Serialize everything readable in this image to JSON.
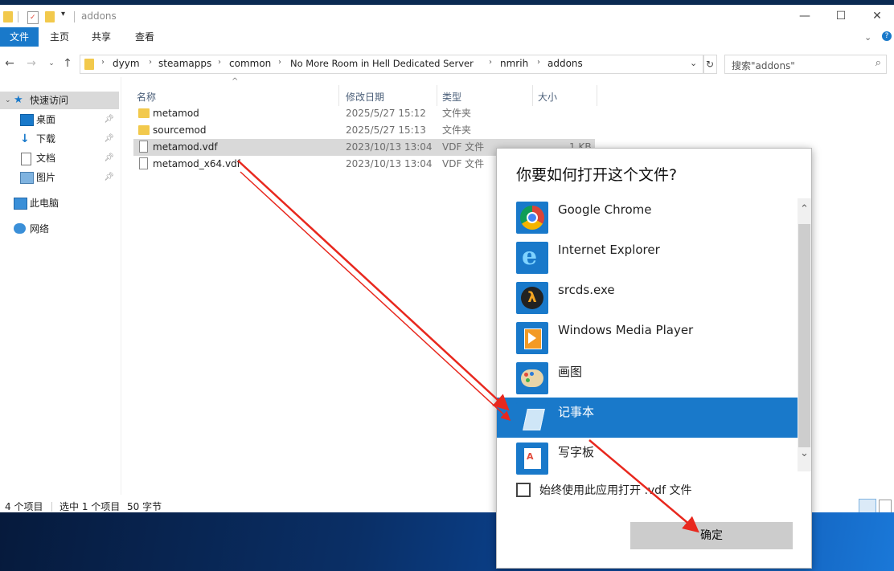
{
  "window": {
    "title": "addons"
  },
  "ribbon": {
    "tabs": [
      "文件",
      "主页",
      "共享",
      "查看"
    ]
  },
  "address": {
    "crumbs": [
      "dyym",
      "steamapps",
      "common",
      "No More Room in Hell Dedicated Server",
      "nmrih",
      "addons"
    ],
    "search_placeholder": "搜索\"addons\""
  },
  "nav": {
    "items": [
      {
        "label": "快速访问",
        "icon": "star-icon"
      },
      {
        "label": "桌面",
        "icon": "desktop-icon"
      },
      {
        "label": "下载",
        "icon": "download-icon"
      },
      {
        "label": "文档",
        "icon": "document-icon"
      },
      {
        "label": "图片",
        "icon": "picture-icon"
      },
      {
        "label": "此电脑",
        "icon": "computer-icon"
      },
      {
        "label": "网络",
        "icon": "network-icon"
      }
    ]
  },
  "files": {
    "columns": [
      "名称",
      "修改日期",
      "类型",
      "大小"
    ],
    "rows": [
      {
        "name": "metamod",
        "date": "2025/5/27 15:12",
        "type": "文件夹",
        "size": "",
        "kind": "folder"
      },
      {
        "name": "sourcemod",
        "date": "2025/5/27 15:13",
        "type": "文件夹",
        "size": "",
        "kind": "folder"
      },
      {
        "name": "metamod.vdf",
        "date": "2023/10/13 13:04",
        "type": "VDF 文件",
        "size": "1 KB",
        "kind": "file"
      },
      {
        "name": "metamod_x64.vdf",
        "date": "2023/10/13 13:04",
        "type": "VDF 文件",
        "size": "",
        "kind": "file"
      }
    ]
  },
  "status": {
    "count": "4 个项目",
    "selection": "选中 1 个项目",
    "size": "50 字节"
  },
  "dialog": {
    "title": "你要如何打开这个文件?",
    "apps": [
      {
        "name": "Google Chrome",
        "icon": "chrome-icon"
      },
      {
        "name": "Internet Explorer",
        "icon": "ie-icon"
      },
      {
        "name": "srcds.exe",
        "icon": "half-life-icon"
      },
      {
        "name": "Windows Media Player",
        "icon": "media-player-icon"
      },
      {
        "name": "画图",
        "icon": "paint-icon"
      },
      {
        "name": "记事本",
        "icon": "notepad-icon"
      },
      {
        "name": "写字板",
        "icon": "wordpad-icon"
      }
    ],
    "selected_app": "记事本",
    "always_use_label": "始终使用此应用打开 .vdf 文件",
    "ok_label": "确定"
  },
  "colors": {
    "accent": "#1979ca",
    "selection_gray": "#d9d9d9",
    "annotation_arrow": "#e8281e"
  }
}
